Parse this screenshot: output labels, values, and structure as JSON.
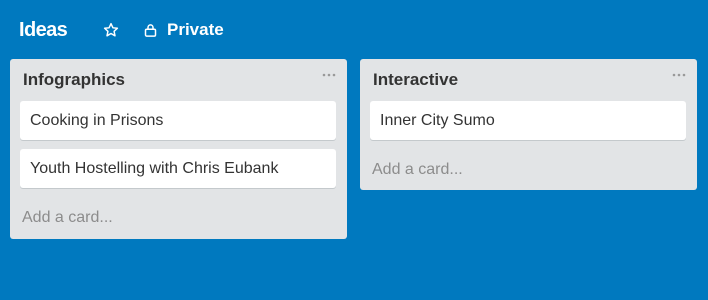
{
  "board": {
    "title": "Ideas",
    "privacy_label": "Private",
    "icons": {
      "star": "star-icon",
      "lock": "lock-icon"
    }
  },
  "lists": [
    {
      "title": "Infographics",
      "cards": [
        "Cooking in Prisons",
        "Youth Hostelling with Chris Eubank"
      ],
      "add_card_label": "Add a card..."
    },
    {
      "title": "Interactive",
      "cards": [
        "Inner City Sumo"
      ],
      "add_card_label": "Add a card..."
    }
  ],
  "colors": {
    "board_background": "#0079bf",
    "list_background": "#e2e4e6",
    "card_background": "#ffffff",
    "muted_text": "#8c8c8c"
  }
}
